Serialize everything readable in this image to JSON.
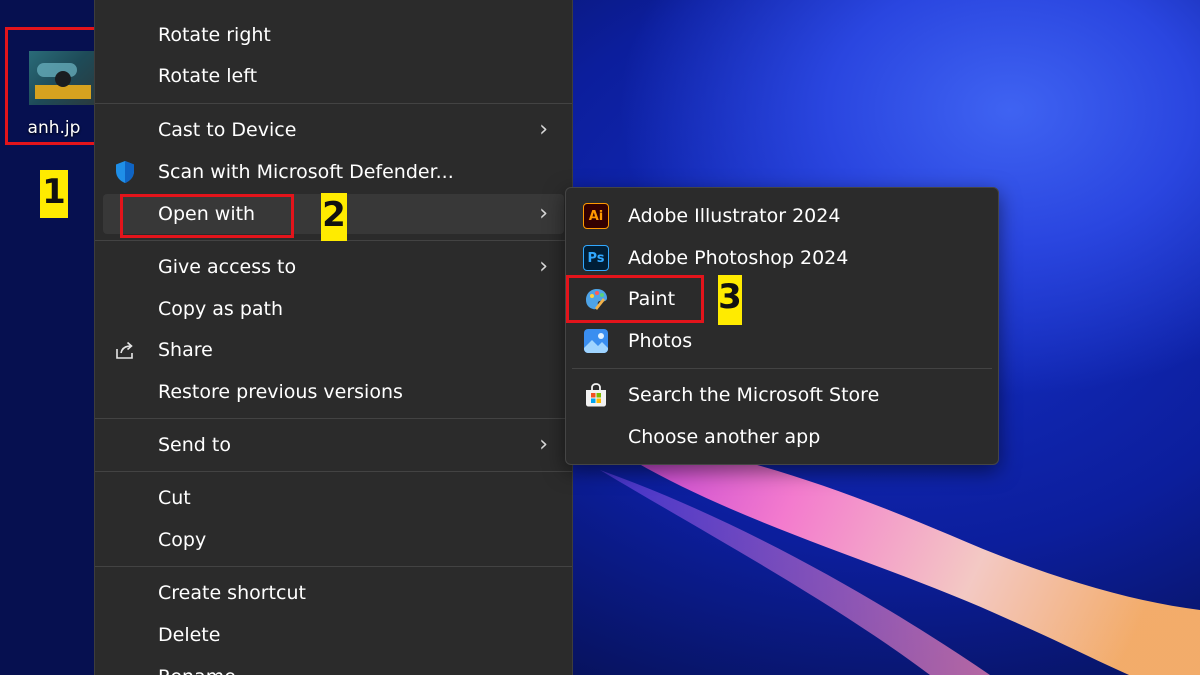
{
  "desktop": {
    "file": {
      "name": "anh.jp"
    }
  },
  "steps": [
    "1",
    "2",
    "3"
  ],
  "context_menu": {
    "items": [
      {
        "label": "Rotate right",
        "icon": null,
        "submenu": false
      },
      {
        "label": "Rotate left",
        "icon": null,
        "submenu": false
      },
      {
        "label": "Cast to Device",
        "icon": null,
        "submenu": true
      },
      {
        "label": "Scan with Microsoft Defender...",
        "icon": "defender-shield-icon",
        "submenu": false
      },
      {
        "label": "Open with",
        "icon": null,
        "submenu": true,
        "highlighted": true
      },
      {
        "label": "Give access to",
        "icon": null,
        "submenu": true
      },
      {
        "label": "Copy as path",
        "icon": null,
        "submenu": false
      },
      {
        "label": "Share",
        "icon": "share-icon",
        "submenu": false
      },
      {
        "label": "Restore previous versions",
        "icon": null,
        "submenu": false
      },
      {
        "label": "Send to",
        "icon": null,
        "submenu": true
      },
      {
        "label": "Cut",
        "icon": null,
        "submenu": false
      },
      {
        "label": "Copy",
        "icon": null,
        "submenu": false
      },
      {
        "label": "Create shortcut",
        "icon": null,
        "submenu": false
      },
      {
        "label": "Delete",
        "icon": null,
        "submenu": false
      },
      {
        "label": "Rename",
        "icon": null,
        "submenu": false
      }
    ]
  },
  "open_with_submenu": {
    "items": [
      {
        "label": "Adobe Illustrator 2024",
        "icon": "adobe-illustrator-icon",
        "icon_text": "Ai"
      },
      {
        "label": "Adobe Photoshop 2024",
        "icon": "adobe-photoshop-icon",
        "icon_text": "Ps"
      },
      {
        "label": "Paint",
        "icon": "paint-icon",
        "highlighted": true
      },
      {
        "label": "Photos",
        "icon": "photos-icon"
      },
      {
        "label": "Search the Microsoft Store",
        "icon": "microsoft-store-icon"
      },
      {
        "label": "Choose another app",
        "icon": null
      }
    ]
  },
  "colors": {
    "menu_bg": "#2b2b2b",
    "highlight_border": "#e3141b",
    "step_badge": "#ffeb00"
  }
}
